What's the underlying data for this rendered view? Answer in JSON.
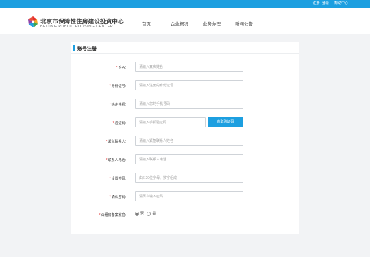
{
  "topbar": {
    "register": "注册",
    "separator": "|",
    "login": "登录",
    "help": "帮助中心"
  },
  "header": {
    "logo_cn": "北京市保障性住房建设投资中心",
    "logo_en": "BEIJING PUBLIC HOUSING CENTER",
    "nav": [
      "首页",
      "企业概况",
      "业务办理",
      "新闻公告"
    ]
  },
  "form": {
    "title": "账号注册",
    "required_mark": "*",
    "fields": [
      {
        "label": "姓名:",
        "placeholder": "请输入真实姓名"
      },
      {
        "label": "身份证号:",
        "placeholder": "请输入注册的身份证号"
      },
      {
        "label": "绑定手机:",
        "placeholder": "请输入您的手机号码"
      },
      {
        "label": "验证码:",
        "placeholder": "请输入手机验证码"
      },
      {
        "label": "紧急联系人:",
        "placeholder": "请输入紧急联系人姓名"
      },
      {
        "label": "联系人电话:",
        "placeholder": "请输入联系人电话"
      },
      {
        "label": "设置密码:",
        "placeholder": "由6-20位字母、数字组成"
      },
      {
        "label": "确认密码:",
        "placeholder": "请再次输入密码"
      }
    ],
    "get_code_button": "获取验证码",
    "public_rental": {
      "label": "公租房备案家庭:",
      "options": [
        "否",
        "是"
      ],
      "selected": "否"
    }
  }
}
